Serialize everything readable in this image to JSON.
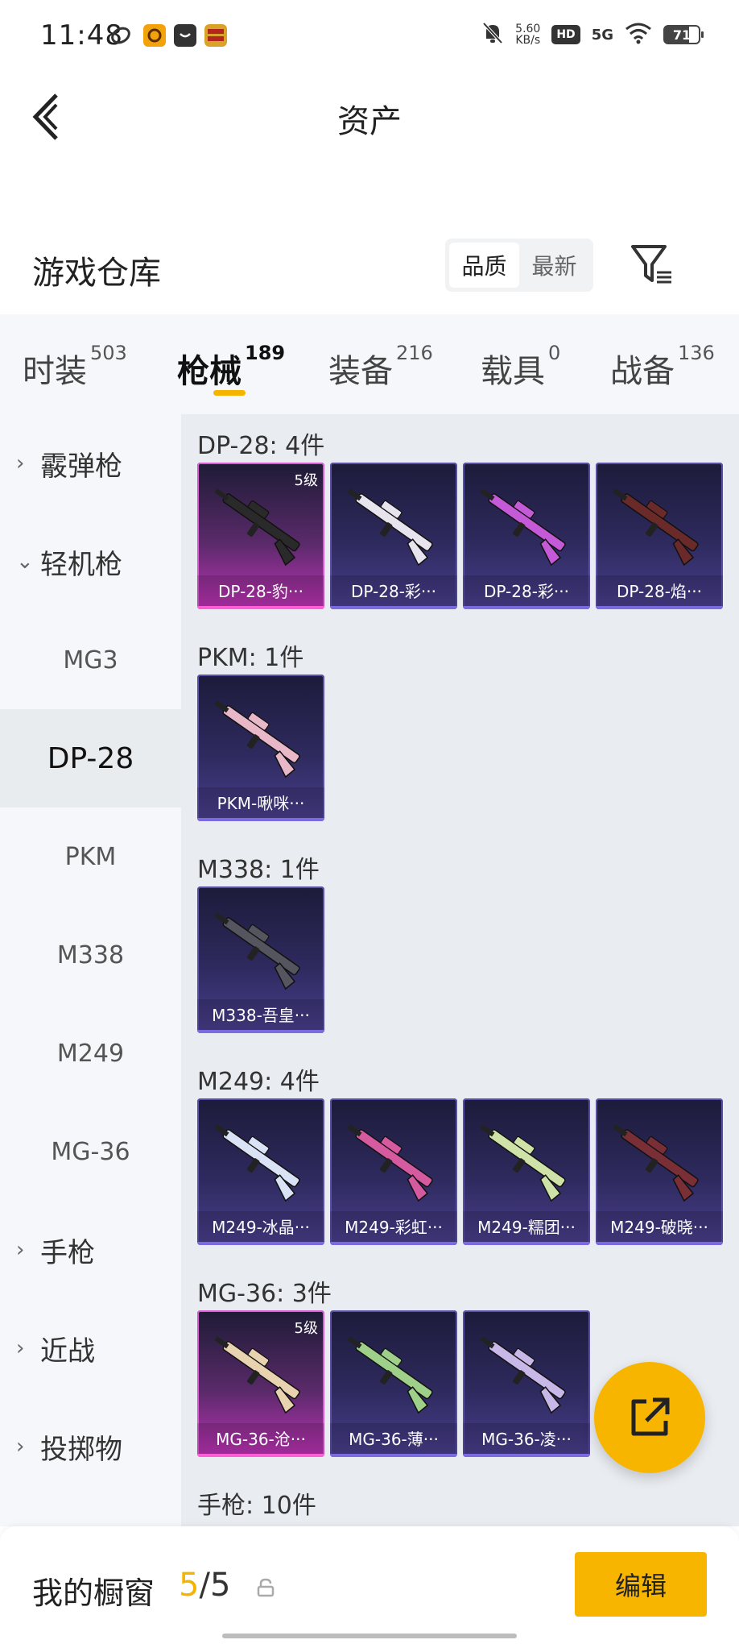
{
  "status_bar": {
    "time": "11:48",
    "net_speed_value": "5.60",
    "net_speed_unit": "KB/s",
    "hd": "HD",
    "signal": "5G",
    "battery": "71"
  },
  "header": {
    "title": "资产"
  },
  "warehouse": {
    "title": "游戏仓库",
    "sort_options": [
      "品质",
      "最新"
    ],
    "sort_active": "品质"
  },
  "tabs": [
    {
      "label": "时装",
      "count": "503"
    },
    {
      "label": "枪械",
      "count": "189",
      "active": true
    },
    {
      "label": "装备",
      "count": "216"
    },
    {
      "label": "载具",
      "count": "0"
    },
    {
      "label": "战备",
      "count": "136"
    }
  ],
  "sidebar": {
    "items": [
      {
        "label": "霰弹枪",
        "type": "group",
        "chevron": "›"
      },
      {
        "label": "轻机枪",
        "type": "group",
        "chevron": "⌄"
      },
      {
        "label": "MG3",
        "type": "sub"
      },
      {
        "label": "DP-28",
        "type": "sub",
        "selected": true
      },
      {
        "label": "PKM",
        "type": "sub"
      },
      {
        "label": "M338",
        "type": "sub"
      },
      {
        "label": "M249",
        "type": "sub"
      },
      {
        "label": "MG-36",
        "type": "sub"
      },
      {
        "label": "手枪",
        "type": "group",
        "chevron": "›"
      },
      {
        "label": "近战",
        "type": "group",
        "chevron": "›"
      },
      {
        "label": "投掷物",
        "type": "group",
        "chevron": "›"
      }
    ]
  },
  "sections": [
    {
      "title": "DP-28: 4件",
      "items": [
        {
          "name": "DP-28-豹···",
          "level": "5级",
          "rarity": "gold",
          "gun_color": "#2a2a2a"
        },
        {
          "name": "DP-28-彩···",
          "rarity": "purple",
          "gun_color": "#e8e4ee"
        },
        {
          "name": "DP-28-彩···",
          "rarity": "purple",
          "gun_color": "#c45ad8"
        },
        {
          "name": "DP-28-焰···",
          "rarity": "purple",
          "gun_color": "#6b2a2a"
        }
      ]
    },
    {
      "title": "PKM: 1件",
      "items": [
        {
          "name": "PKM-啾咪···",
          "rarity": "purple",
          "gun_color": "#e9b8c8"
        }
      ]
    },
    {
      "title": "M338: 1件",
      "items": [
        {
          "name": "M338-吾皇···",
          "rarity": "purple",
          "gun_color": "#55555f"
        }
      ]
    },
    {
      "title": "M249: 4件",
      "items": [
        {
          "name": "M249-冰晶···",
          "rarity": "purple",
          "gun_color": "#d9e3f5"
        },
        {
          "name": "M249-彩虹···",
          "rarity": "purple",
          "gun_color": "#d65aa0"
        },
        {
          "name": "M249-糯团···",
          "rarity": "purple",
          "gun_color": "#cfe3a8"
        },
        {
          "name": "M249-破晓···",
          "rarity": "purple",
          "gun_color": "#7a2f36"
        }
      ]
    },
    {
      "title": "MG-36: 3件",
      "items": [
        {
          "name": "MG-36-沧···",
          "level": "5级",
          "rarity": "gold",
          "gun_color": "#e8d2b0"
        },
        {
          "name": "MG-36-薄···",
          "rarity": "purple",
          "gun_color": "#9fd08a"
        },
        {
          "name": "MG-36-凌···",
          "rarity": "purple",
          "gun_color": "#c8b8e8"
        }
      ]
    },
    {
      "title": "手枪: 10件",
      "items": []
    }
  ],
  "bottom_bar": {
    "showcase_label": "我的橱窗",
    "showcase_current": "5",
    "showcase_sep": "/",
    "showcase_total": "5",
    "edit_label": "编辑"
  },
  "colors": {
    "accent": "#f7b500",
    "purple_card": "#4a3f8e",
    "gold_card": "#c033b8"
  }
}
